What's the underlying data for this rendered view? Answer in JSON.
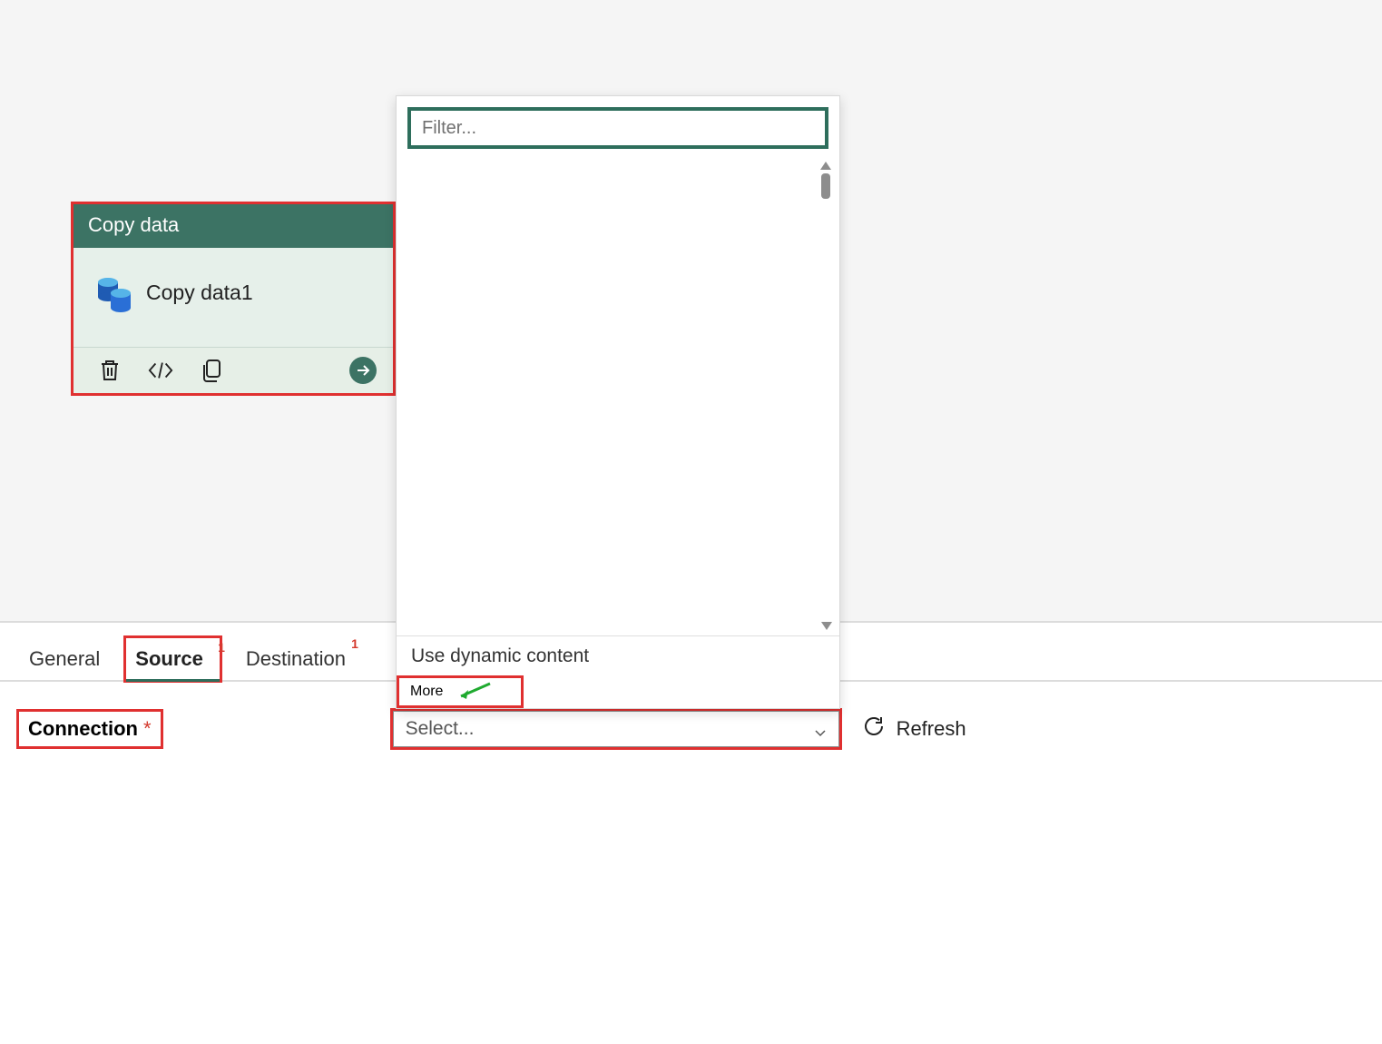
{
  "activity": {
    "title": "Copy data",
    "name": "Copy data1"
  },
  "dropdown": {
    "filter_placeholder": "Filter...",
    "option_dynamic": "Use dynamic content",
    "option_more": "More"
  },
  "tabs": {
    "general": "General",
    "source": "Source",
    "source_badge": "1",
    "destination": "Destination",
    "destination_badge": "1"
  },
  "form": {
    "connection_label": "Connection",
    "select_placeholder": "Select...",
    "refresh_label": "Refresh"
  }
}
